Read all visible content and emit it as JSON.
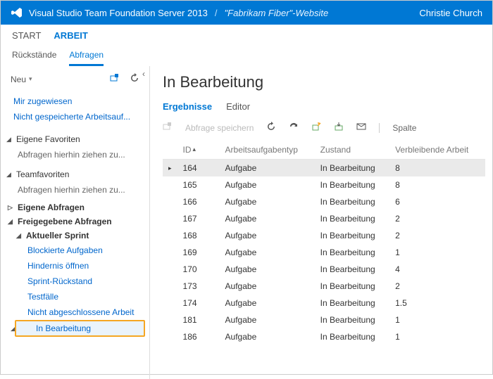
{
  "header": {
    "product": "Visual Studio Team Foundation Server 2013",
    "separator": "/",
    "project": "\"Fabrikam Fiber\"-Website",
    "user": "Christie Church"
  },
  "topnav": {
    "start": "START",
    "arbeit": "ARBEIT"
  },
  "subnav": {
    "backlogs": "Rückstände",
    "queries": "Abfragen"
  },
  "sidebar": {
    "new_label": "Neu",
    "collapse_glyph": "‹",
    "quick_links": {
      "assigned_to_me": "Mir zugewiesen",
      "unsaved_work_items": "Nicht gespeicherte Arbeitsauf..."
    },
    "sections": {
      "own_favorites": "Eigene Favoriten",
      "own_fav_hint": "Abfragen hierhin ziehen zu...",
      "team_favorites": "Teamfavoriten",
      "team_fav_hint": "Abfragen hierhin ziehen zu..."
    },
    "tree": {
      "own_queries": "Eigene Abfragen",
      "shared_queries": "Freigegebene Abfragen",
      "current_sprint": "Aktueller Sprint",
      "leaves": {
        "blocked": "Blockierte Aufgaben",
        "open_impediment": "Hindernis öffnen",
        "sprint_backlog": "Sprint-Rückstand",
        "test_cases": "Testfälle",
        "unfinished": "Nicht abgeschlossene Arbeit",
        "in_progress": "In Bearbeitung"
      }
    }
  },
  "main": {
    "title": "In Bearbeitung",
    "tabs": {
      "results": "Ergebnisse",
      "editor": "Editor"
    },
    "toolbar": {
      "save_query": "Abfrage speichern",
      "column": "Spalte"
    },
    "columns": {
      "id": "ID",
      "type": "Arbeitsaufgabentyp",
      "state": "Zustand",
      "remaining": "Verbleibende Arbeit"
    },
    "rows": [
      {
        "id": "164",
        "type": "Aufgabe",
        "state": "In Bearbeitung",
        "remaining": "8",
        "selected": true
      },
      {
        "id": "165",
        "type": "Aufgabe",
        "state": "In Bearbeitung",
        "remaining": "8"
      },
      {
        "id": "166",
        "type": "Aufgabe",
        "state": "In Bearbeitung",
        "remaining": "6"
      },
      {
        "id": "167",
        "type": "Aufgabe",
        "state": "In Bearbeitung",
        "remaining": "2"
      },
      {
        "id": "168",
        "type": "Aufgabe",
        "state": "In Bearbeitung",
        "remaining": "2"
      },
      {
        "id": "169",
        "type": "Aufgabe",
        "state": "In Bearbeitung",
        "remaining": "1"
      },
      {
        "id": "170",
        "type": "Aufgabe",
        "state": "In Bearbeitung",
        "remaining": "4"
      },
      {
        "id": "173",
        "type": "Aufgabe",
        "state": "In Bearbeitung",
        "remaining": "2"
      },
      {
        "id": "174",
        "type": "Aufgabe",
        "state": "In Bearbeitung",
        "remaining": "1.5"
      },
      {
        "id": "181",
        "type": "Aufgabe",
        "state": "In Bearbeitung",
        "remaining": "1"
      },
      {
        "id": "186",
        "type": "Aufgabe",
        "state": "In Bearbeitung",
        "remaining": "1"
      }
    ]
  }
}
